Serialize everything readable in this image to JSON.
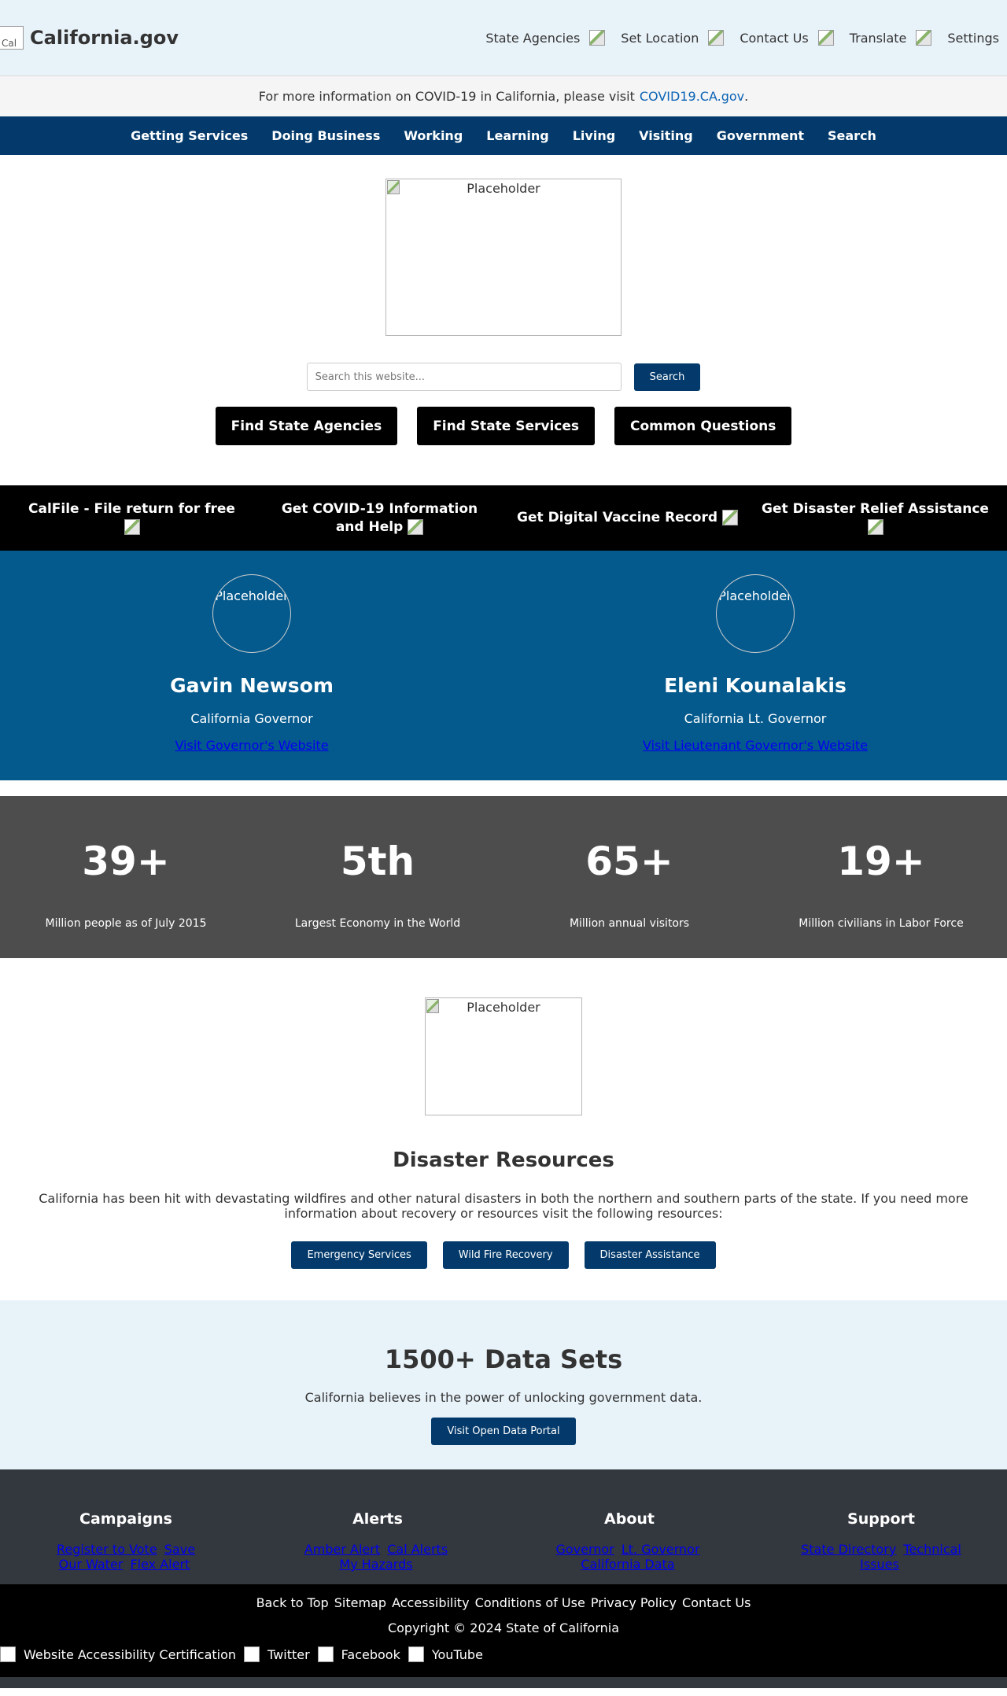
{
  "header": {
    "logo_alt": "Cal",
    "title": "California.gov",
    "utility_nav": [
      {
        "label": "State Agencies"
      },
      {
        "label": "Set Location"
      },
      {
        "label": "Contact Us"
      },
      {
        "label": "Translate"
      },
      {
        "label": "Settings"
      }
    ]
  },
  "covid": {
    "text": "For more information on COVID-19 in California, please visit",
    "link": "COVID19.CA.gov",
    "suffix": "."
  },
  "main_nav": [
    "Getting Services",
    "Doing Business",
    "Working",
    "Learning",
    "Living",
    "Visiting",
    "Government",
    "Search"
  ],
  "hero": {
    "image_alt": "Placeholder",
    "search_placeholder": "Search this website...",
    "search_button": "Search",
    "cta": [
      "Find State Agencies",
      "Find State Services",
      "Common Questions"
    ]
  },
  "promo": [
    "CalFile - File return for free",
    "Get COVID-19 Information and Help",
    "Get Digital Vaccine Record",
    "Get Disaster Relief Assistance"
  ],
  "leaders": [
    {
      "photo_alt": "Placeholder",
      "name": "Gavin Newsom",
      "title": "California Governor",
      "link": "Visit Governor's Website"
    },
    {
      "photo_alt": "Placeholder",
      "name": "Eleni Kounalakis",
      "title": "California Lt. Governor",
      "link": "Visit Lieutenant Governor's Website"
    }
  ],
  "stats": [
    {
      "value": "39+",
      "label": "Million people as of July 2015"
    },
    {
      "value": "5th",
      "label": "Largest Economy in the World"
    },
    {
      "value": "65+",
      "label": "Million annual visitors"
    },
    {
      "value": "19+",
      "label": "Million civilians in Labor Force"
    }
  ],
  "disaster": {
    "image_alt": "Placeholder",
    "title": "Disaster Resources",
    "text": "California has been hit with devastating wildfires and other natural disasters in both the northern and southern parts of the state. If you need more information about recovery or resources visit the following resources:",
    "buttons": [
      "Emergency Services",
      "Wild Fire Recovery",
      "Disaster Assistance"
    ]
  },
  "datasets": {
    "title": "1500+ Data Sets",
    "text": "California believes in the power of unlocking government data.",
    "button": "Visit Open Data Portal"
  },
  "footer": {
    "columns": [
      {
        "title": "Campaigns",
        "links": [
          "Register to Vote",
          "Save Our Water",
          "Flex Alert"
        ]
      },
      {
        "title": "Alerts",
        "links": [
          "Amber Alert",
          "Cal Alerts",
          "My Hazards"
        ]
      },
      {
        "title": "About",
        "links": [
          "Governor",
          "Lt. Governor",
          "California Data"
        ]
      },
      {
        "title": "Support",
        "links": [
          "State Directory",
          "Technical Issues"
        ]
      }
    ],
    "bottom_links": [
      "Back to Top",
      "Sitemap",
      "Accessibility",
      "Conditions of Use",
      "Privacy Policy",
      "Contact Us"
    ],
    "copyright": "Copyright © 2024 State of California",
    "social": [
      "Website Accessibility Certification",
      "Twitter",
      "Facebook",
      "YouTube"
    ]
  },
  "colors": {
    "header_bg": "#e8f2f9",
    "nav_bg": "#033a6b",
    "leaders_bg": "#045a8d",
    "stats_bg": "#4d4d4d",
    "footer_bg": "#33373e",
    "link": "#0b63b5"
  }
}
